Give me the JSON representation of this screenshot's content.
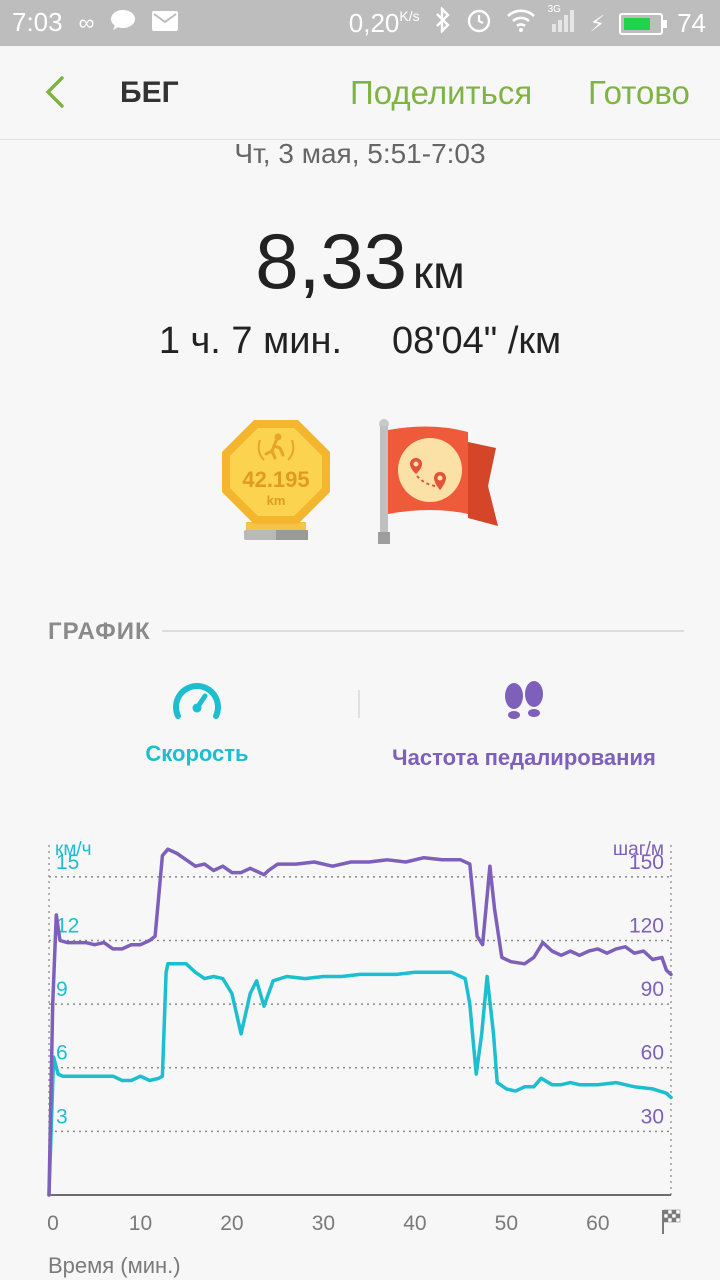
{
  "status_bar": {
    "time": "7:03",
    "network_speed": "0,20",
    "network_speed_unit": "K/s",
    "network_type": "3G",
    "battery": "74"
  },
  "header": {
    "title": "БЕГ",
    "share_label": "Поделиться",
    "done_label": "Готово"
  },
  "summary": {
    "date": "Чт, 3 мая, 5:51-7:03",
    "distance": "8,33",
    "distance_unit": "км",
    "duration": "1 ч. 7 мин.",
    "pace": "08'04\" /км"
  },
  "badges": {
    "marathon_value": "42.195",
    "marathon_unit": "km"
  },
  "graph_section": {
    "label": "ГРАФИК"
  },
  "tabs": {
    "speed": "Скорость",
    "cadence": "Частота педалирования"
  },
  "colors": {
    "accent": "#7fb444",
    "speed": "#1bbfcf",
    "cadence": "#7e5fba"
  },
  "chart_data": {
    "type": "line",
    "xlabel": "Время (мин.)",
    "xticks": [
      0,
      10,
      20,
      30,
      40,
      50,
      60
    ],
    "xlim": [
      0,
      68
    ],
    "y_left": {
      "label": "км/ч",
      "ticks": [
        3,
        6,
        9,
        12,
        15
      ],
      "range": [
        0,
        16.5
      ]
    },
    "y_right": {
      "label": "шаг/м",
      "ticks": [
        30,
        60,
        90,
        120,
        150
      ],
      "range": [
        0,
        165
      ]
    },
    "grid": true,
    "series": [
      {
        "name": "Скорость",
        "axis": "left",
        "points": [
          [
            0,
            0
          ],
          [
            0.5,
            6.5
          ],
          [
            1,
            5.7
          ],
          [
            1.5,
            5.6
          ],
          [
            3,
            5.6
          ],
          [
            5,
            5.6
          ],
          [
            6,
            5.6
          ],
          [
            7,
            5.6
          ],
          [
            8,
            5.4
          ],
          [
            9,
            5.4
          ],
          [
            10,
            5.6
          ],
          [
            11,
            5.4
          ],
          [
            12,
            5.5
          ],
          [
            12.4,
            5.6
          ],
          [
            12.8,
            10.5
          ],
          [
            13,
            10.9
          ],
          [
            15,
            10.9
          ],
          [
            16,
            10.5
          ],
          [
            17,
            10.2
          ],
          [
            18,
            10.3
          ],
          [
            19,
            10.2
          ],
          [
            20,
            9.5
          ],
          [
            21,
            7.6
          ],
          [
            22,
            9.5
          ],
          [
            22.7,
            10.1
          ],
          [
            23.5,
            8.9
          ],
          [
            24.5,
            10.1
          ],
          [
            26,
            10.3
          ],
          [
            28,
            10.2
          ],
          [
            30,
            10.3
          ],
          [
            32,
            10.3
          ],
          [
            34,
            10.4
          ],
          [
            36,
            10.4
          ],
          [
            38,
            10.4
          ],
          [
            40,
            10.5
          ],
          [
            42,
            10.5
          ],
          [
            44,
            10.5
          ],
          [
            45.5,
            10.2
          ],
          [
            46,
            9
          ],
          [
            46.7,
            5.7
          ],
          [
            47.3,
            7.6
          ],
          [
            47.9,
            10.3
          ],
          [
            48.6,
            7.6
          ],
          [
            49,
            5.3
          ],
          [
            50,
            5
          ],
          [
            51,
            4.9
          ],
          [
            52,
            5.1
          ],
          [
            53,
            5.1
          ],
          [
            53.8,
            5.5
          ],
          [
            55,
            5.2
          ],
          [
            56,
            5.2
          ],
          [
            57,
            5.3
          ],
          [
            58,
            5.2
          ],
          [
            59,
            5.2
          ],
          [
            60,
            5.2
          ],
          [
            62,
            5.3
          ],
          [
            64,
            5.1
          ],
          [
            66,
            5
          ],
          [
            67.5,
            4.8
          ],
          [
            68,
            4.6
          ]
        ]
      },
      {
        "name": "Частота педалирования",
        "axis": "right",
        "points": [
          [
            0,
            0
          ],
          [
            0.4,
            90
          ],
          [
            0.8,
            132
          ],
          [
            1.2,
            120
          ],
          [
            2,
            119
          ],
          [
            4,
            119
          ],
          [
            5,
            118
          ],
          [
            6,
            119
          ],
          [
            7,
            116
          ],
          [
            8,
            116
          ],
          [
            9,
            118
          ],
          [
            10,
            118
          ],
          [
            11,
            120
          ],
          [
            11.6,
            122
          ],
          [
            12.4,
            160
          ],
          [
            13,
            163
          ],
          [
            14,
            161
          ],
          [
            15,
            158
          ],
          [
            16,
            155
          ],
          [
            17,
            156
          ],
          [
            18,
            153
          ],
          [
            19,
            155
          ],
          [
            20,
            152
          ],
          [
            21,
            152
          ],
          [
            22,
            154
          ],
          [
            23,
            152
          ],
          [
            23.5,
            151
          ],
          [
            24,
            153
          ],
          [
            25,
            156
          ],
          [
            27,
            156
          ],
          [
            29,
            157
          ],
          [
            31,
            155
          ],
          [
            33,
            157
          ],
          [
            35,
            157
          ],
          [
            37,
            158
          ],
          [
            39,
            157
          ],
          [
            41,
            159
          ],
          [
            43,
            158
          ],
          [
            45,
            158
          ],
          [
            46,
            156
          ],
          [
            46.8,
            122
          ],
          [
            47.4,
            118
          ],
          [
            48.2,
            155
          ],
          [
            48.7,
            135
          ],
          [
            49.5,
            112
          ],
          [
            50.5,
            110
          ],
          [
            52,
            109
          ],
          [
            53,
            112
          ],
          [
            54,
            119
          ],
          [
            55,
            115
          ],
          [
            56,
            113
          ],
          [
            57,
            115
          ],
          [
            58,
            113
          ],
          [
            59,
            115
          ],
          [
            60,
            116
          ],
          [
            61,
            114
          ],
          [
            62,
            116
          ],
          [
            63,
            117
          ],
          [
            64,
            114
          ],
          [
            65,
            115
          ],
          [
            66,
            111
          ],
          [
            67,
            112
          ],
          [
            67.5,
            106
          ],
          [
            68,
            104
          ]
        ]
      }
    ]
  }
}
